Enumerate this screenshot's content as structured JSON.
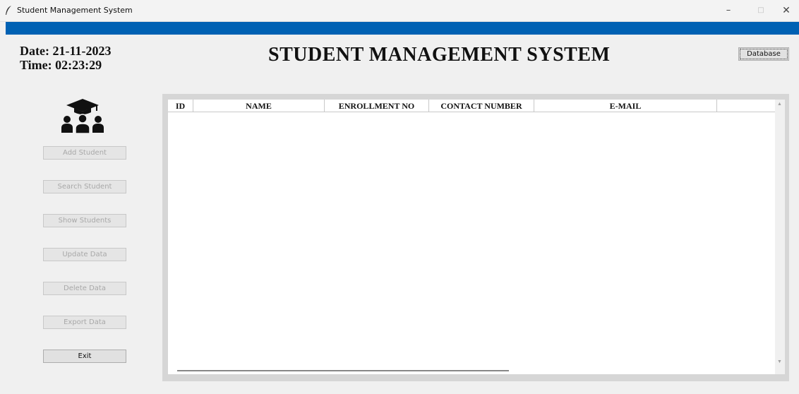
{
  "window": {
    "title": "Student Management System",
    "minimize": "–",
    "maximize": "□",
    "close": "✕"
  },
  "header": {
    "date": "Date: 21-11-2023",
    "time": "Time: 02:23:29",
    "title": "STUDENT MANAGEMENT SYSTEM",
    "database_button": "Database"
  },
  "sidebar": {
    "buttons": [
      {
        "label": "Add Student",
        "enabled": false
      },
      {
        "label": "Search Student",
        "enabled": false
      },
      {
        "label": "Show Students",
        "enabled": false
      },
      {
        "label": "Update Data",
        "enabled": false
      },
      {
        "label": "Delete Data",
        "enabled": false
      },
      {
        "label": "Export Data",
        "enabled": false
      },
      {
        "label": "Exit",
        "enabled": true
      }
    ]
  },
  "table": {
    "columns": [
      "ID",
      "NAME",
      "ENROLLMENT NO",
      "CONTACT NUMBER",
      "E-MAIL",
      ""
    ],
    "rows": []
  },
  "colors": {
    "accent_band": "#0061b3",
    "background": "#f0f0f0"
  }
}
